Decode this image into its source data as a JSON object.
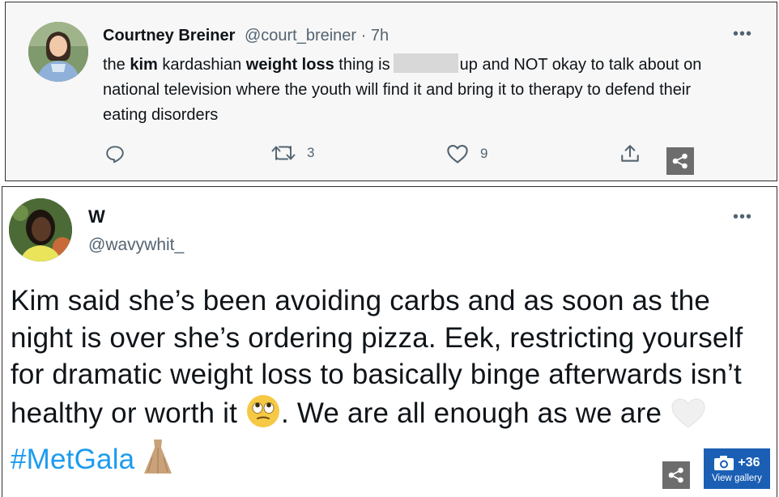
{
  "tweet1": {
    "author_name": "Courtney Breiner",
    "author_handle": "@court_breiner",
    "separator": " · ",
    "time_ago": "7h",
    "more_label": "•••",
    "text": {
      "p1": "the ",
      "kw1": "kim",
      "p2": " kardashian ",
      "kw2": "weight loss",
      "p3": " thing is",
      "p4": "up and NOT okay to talk about on national television where the youth will find it and bring it to therapy to defend their eating disorders"
    },
    "actions": {
      "reply_icon": "reply-icon",
      "retweet_icon": "retweet-icon",
      "retweet_count": "3",
      "like_icon": "heart-icon",
      "like_count": "9",
      "share_icon": "share-upload-icon"
    }
  },
  "tweet2": {
    "author_name": "W",
    "author_handle": "@wavywhit_",
    "more_label": "•••",
    "text": {
      "p1": "Kim said she’s been avoiding carbs and as soon as the night is over she’s ordering pizza. Eek, restricting yourself for dramatic weight loss to basically binge afterwards isn’t healthy or worth it ",
      "p2": ". We are all enough as we are ",
      "hashtag": "#MetGala",
      "emoji1": "rolling-eyes-emoji",
      "emoji2": "white-heart-emoji",
      "emoji3": "dress-emoji"
    }
  },
  "overlay": {
    "share_icon": "share-icon",
    "gallery_count": "+36",
    "gallery_label": "View gallery",
    "gallery_icon": "camera-icon"
  },
  "colors": {
    "link": "#1d9bf0",
    "secondary_text": "#536471",
    "gallery_bg": "#1a5fb4",
    "share_bg": "#6d6d6d"
  }
}
